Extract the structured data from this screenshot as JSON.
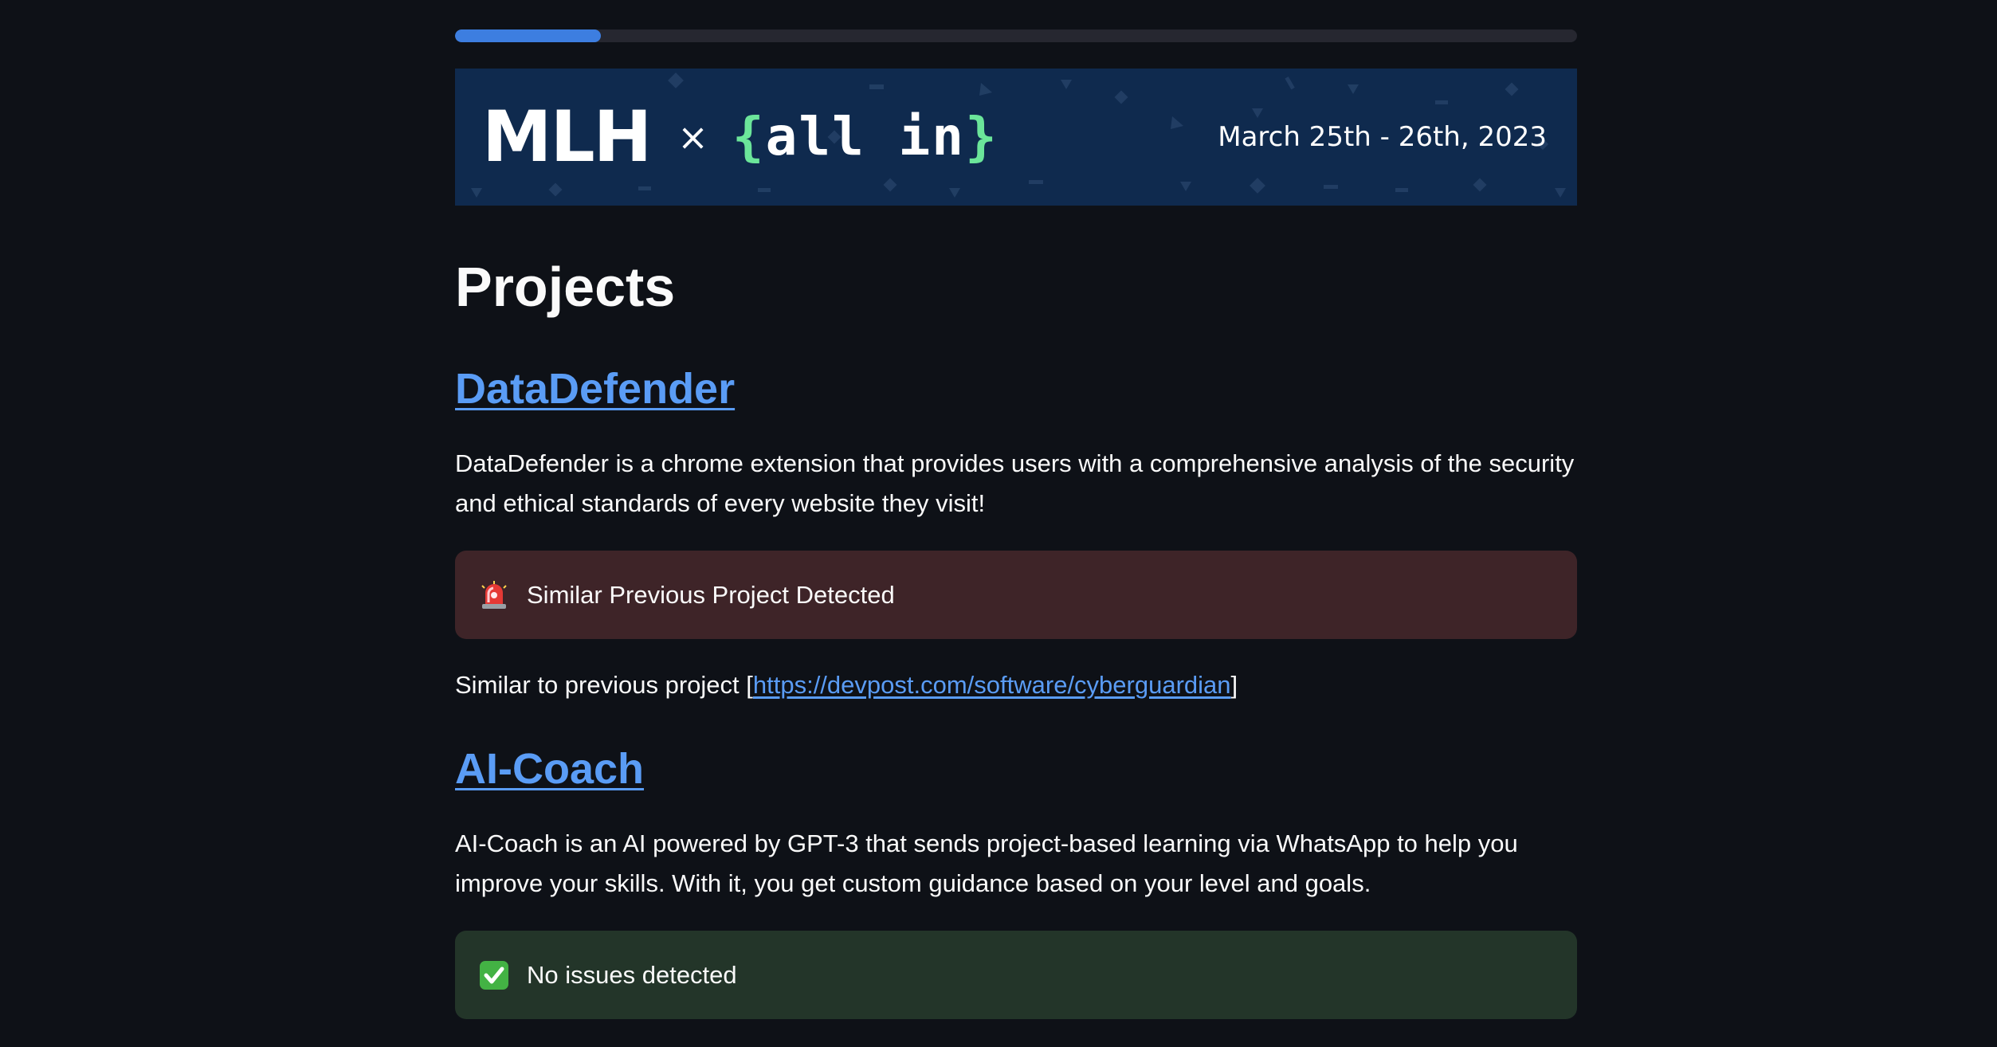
{
  "progress": {
    "fraction": 0.13,
    "color": "#3d7ee0"
  },
  "banner": {
    "mlh": "MLH",
    "times": "×",
    "allin_open": "{",
    "allin_text": "all in",
    "allin_close": "}",
    "date": "March 25th - 26th, 2023",
    "background": "#0f2a4e",
    "accent": "#6be59a"
  },
  "page_title": "Projects",
  "projects": [
    {
      "title": "DataDefender",
      "description": "DataDefender is a chrome extension that provides users with a comprehensive analysis of the security and ethical standards of every website they visit!",
      "alert": {
        "icon": "siren-icon",
        "text": "Similar Previous Project Detected",
        "status": "warning"
      },
      "similar_prefix": "Similar to previous project [",
      "similar_link": "https://devpost.com/software/cyberguardian",
      "similar_suffix": "]"
    },
    {
      "title": "AI-Coach",
      "description": "AI-Coach is an AI powered by GPT-3 that sends project-based learning via WhatsApp to help you improve your skills. With it, you get custom guidance based on your level and goals.",
      "alert": {
        "icon": "check-mark-icon",
        "text": "No issues detected",
        "status": "success"
      }
    }
  ],
  "colors": {
    "background": "#0e1117",
    "link": "#5a9cf5",
    "warning_bg": "#3e2428",
    "success_bg": "#233529"
  }
}
